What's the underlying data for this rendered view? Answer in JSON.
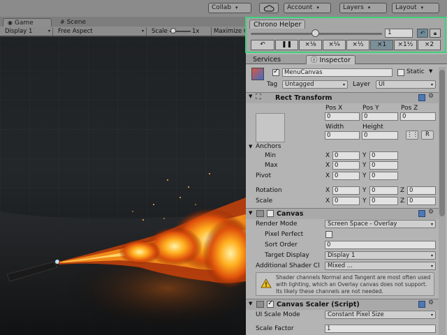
{
  "toolbar": {
    "collab_label": "Collab",
    "cloud_icon": "cloud-icon",
    "account_label": "Account",
    "layers_label": "Layers",
    "layout_label": "Layout"
  },
  "game_view": {
    "tabs": [
      {
        "label": "Game"
      },
      {
        "label": "Scene"
      }
    ],
    "display": "Display 1",
    "aspect": "Free Aspect",
    "scale_label": "Scale",
    "scale_value": "1x",
    "maximize_label": "Maximize C"
  },
  "chrono": {
    "title": "Chrono Helper",
    "speed_value": "1",
    "slider_fraction": 0.5,
    "buttons": [
      {
        "label": "↶",
        "icon": "reset-icon"
      },
      {
        "label": "❚❚",
        "icon": "pause-icon"
      },
      {
        "label": "×⅛"
      },
      {
        "label": "×¼"
      },
      {
        "label": "×½"
      },
      {
        "label": "×1"
      },
      {
        "label": "×1½"
      },
      {
        "label": "×2"
      }
    ],
    "selected": "×1"
  },
  "inspector_tabs": [
    {
      "label": "Services"
    },
    {
      "label": "Inspector"
    }
  ],
  "object": {
    "name": "MenuCanvas",
    "static_label": "Static",
    "tag_label": "Tag",
    "tag_value": "Untagged",
    "layer_label": "Layer",
    "layer_value": "UI"
  },
  "rect_transform": {
    "title": "Rect Transform",
    "pos_x_label": "Pos X",
    "pos_y_label": "Pos Y",
    "pos_z_label": "Pos Z",
    "pos_x": "0",
    "pos_y": "0",
    "pos_z": "0",
    "width_label": "Width",
    "height_label": "Height",
    "width": "0",
    "height": "0",
    "r_label": "R",
    "anchors_label": "Anchors",
    "min_label": "Min",
    "max_label": "Max",
    "pivot_label": "Pivot",
    "rotation_label": "Rotation",
    "scale_label": "Scale",
    "x_label": "X",
    "y_label": "Y",
    "z_label": "Z",
    "anchor_min_x": "0",
    "anchor_min_y": "0",
    "anchor_max_x": "0",
    "anchor_max_y": "0",
    "pivot_x": "0",
    "pivot_y": "0",
    "rot_x": "0",
    "rot_y": "0",
    "rot_z": "0",
    "scale_x": "0",
    "scale_y": "0",
    "scale_z": "0"
  },
  "canvas": {
    "title": "Canvas",
    "render_mode_label": "Render Mode",
    "render_mode_value": "Screen Space - Overlay",
    "pixel_perfect_label": "Pixel Perfect",
    "sort_order_label": "Sort Order",
    "sort_order_value": "0",
    "target_display_label": "Target Display",
    "target_display_value": "Display 1",
    "shader_channels_label": "Additional Shader Cl",
    "shader_channels_value": "Mixed ...",
    "warning_text": "Shader channels Normal and Tangent are most often used with lighting, which an Overlay canvas does not support. Its likely these channels are not needed."
  },
  "canvas_scaler": {
    "title": "Canvas Scaler (Script)",
    "ui_scale_mode_label": "UI Scale Mode",
    "ui_scale_mode_value": "Constant Pixel Size",
    "scale_factor_label": "Scale Factor",
    "scale_factor_value": "1"
  }
}
